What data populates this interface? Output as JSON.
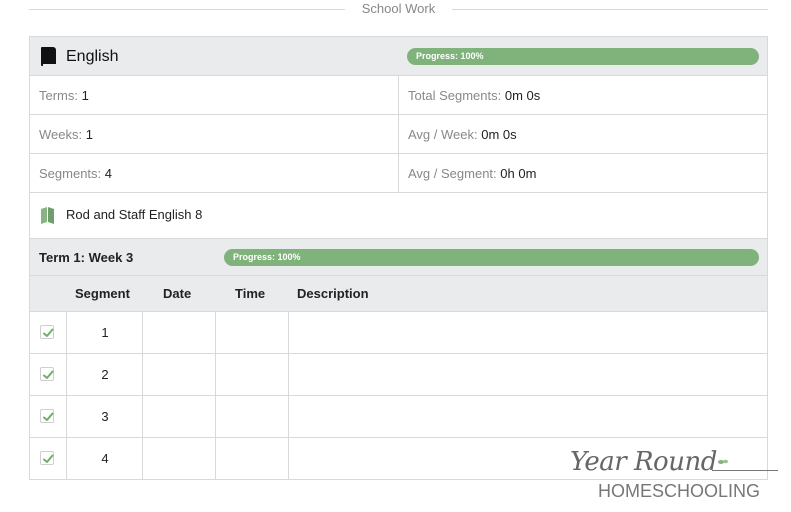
{
  "section": {
    "title": "School Work"
  },
  "subject": {
    "name": "English",
    "progress_label": "Progress: 100%",
    "progress": 1.0
  },
  "stats": [
    {
      "left_label": "Terms:",
      "left_value": "1",
      "right_label": "Total Segments:",
      "right_value": "0m 0s"
    },
    {
      "left_label": "Weeks:",
      "left_value": "1",
      "right_label": "Avg / Week:",
      "right_value": "0m 0s"
    },
    {
      "left_label": "Segments:",
      "left_value": "4",
      "right_label": "Avg / Segment:",
      "right_value": "0h 0m"
    }
  ],
  "book": {
    "title": "Rod and Staff English 8"
  },
  "term": {
    "title": "Term 1: Week 3",
    "progress_label": "Progress: 100%",
    "progress": 1.0
  },
  "table": {
    "columns": [
      "Segment",
      "Date",
      "Time",
      "Description"
    ],
    "rows": [
      {
        "checked": true,
        "segment": "1",
        "date": "",
        "time": "",
        "description": ""
      },
      {
        "checked": true,
        "segment": "2",
        "date": "",
        "time": "",
        "description": ""
      },
      {
        "checked": true,
        "segment": "3",
        "date": "",
        "time": "",
        "description": ""
      },
      {
        "checked": true,
        "segment": "4",
        "date": "",
        "time": "",
        "description": ""
      }
    ]
  },
  "watermark": {
    "script": "Year Round",
    "caps": "HOMESCHOOLING"
  },
  "colors": {
    "progress": "#80b27b",
    "header_bg": "#e9ebec",
    "check": "#6fae6a",
    "book_icon": "#86b482"
  }
}
